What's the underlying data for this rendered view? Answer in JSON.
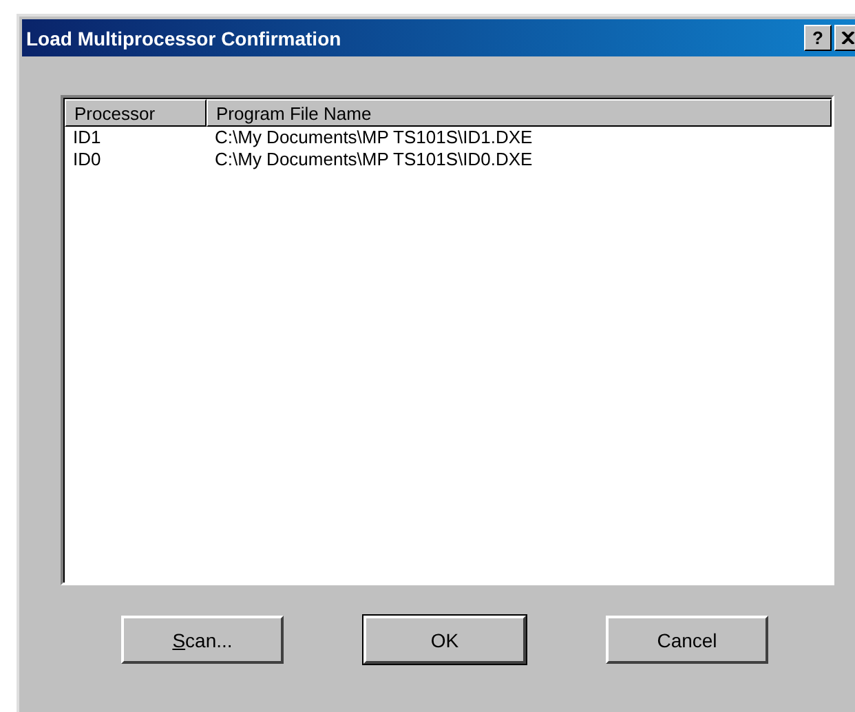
{
  "window": {
    "title": "Load Multiprocessor Confirmation",
    "help_button": "?"
  },
  "table": {
    "columns": [
      "Processor",
      "Program File Name"
    ],
    "rows": [
      [
        "ID1",
        "C:\\My Documents\\MP TS101S\\ID1.DXE"
      ],
      [
        "ID0",
        "C:\\My Documents\\MP TS101S\\ID0.DXE"
      ]
    ]
  },
  "buttons": [
    {
      "access_key": "S",
      "rest": "can...",
      "default": false
    },
    {
      "rest": "OK",
      "default": true
    },
    {
      "rest": "Cancel",
      "default": false
    }
  ]
}
